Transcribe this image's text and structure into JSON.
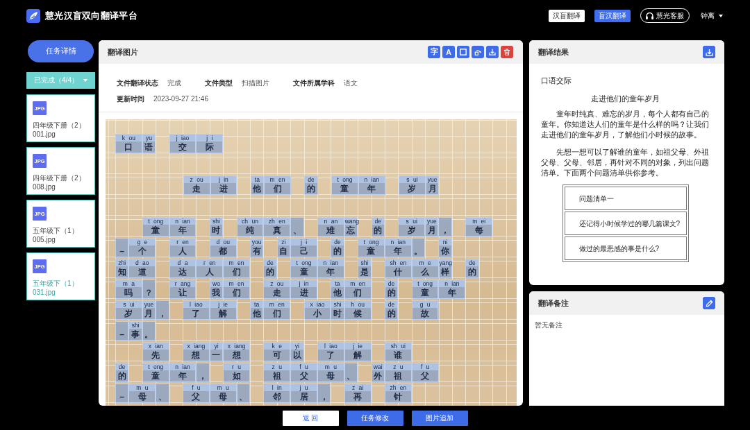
{
  "app": {
    "title": "慧光汉盲双向翻译平台"
  },
  "top_nav": {
    "modes": [
      {
        "label": "汉盲翻译",
        "selected": false
      },
      {
        "label": "盲汉翻译",
        "selected": true
      }
    ],
    "support": {
      "label": "慧光客服"
    },
    "user": {
      "name": "钟离"
    }
  },
  "sidebar": {
    "task_button": "任务详情",
    "filter": {
      "label": "已完成（4/4）"
    },
    "files": [
      {
        "type_label": "JPG",
        "name": "四年级下册（2）001.jpg",
        "selected": false
      },
      {
        "type_label": "JPG",
        "name": "四年级下册（2）008.jpg",
        "selected": false
      },
      {
        "type_label": "JPG",
        "name": "五年级下（1）005.jpg",
        "selected": false
      },
      {
        "type_label": "JPG",
        "name": "五年级下（1）031.jpg",
        "selected": true
      }
    ]
  },
  "image_panel": {
    "title": "翻译图片",
    "tools": [
      {
        "kind": "glyph",
        "label": "字"
      },
      {
        "kind": "glyph",
        "label": "A"
      },
      {
        "kind": "frame"
      },
      {
        "kind": "rotate"
      },
      {
        "kind": "download"
      },
      {
        "kind": "delete"
      }
    ],
    "details": [
      {
        "label": "文件翻译状态",
        "value": "完成"
      },
      {
        "label": "文件类型",
        "value": "扫描图片"
      },
      {
        "label": "文件所属学科",
        "value": "语文"
      },
      {
        "label": "更新时间",
        "value": "2023-09-27 21:46"
      }
    ],
    "scan": {
      "lines": [
        {
          "kind": "heading",
          "words": [
            [
              {
                "char": "口",
                "pinyin": "k ou"
              },
              {
                "char": "语",
                "pinyin": "yu"
              }
            ],
            [
              {
                "char": "交",
                "pinyin": "j iao"
              },
              {
                "char": "际",
                "pinyin": "j i"
              }
            ]
          ]
        },
        {
          "kind": "title",
          "words": [
            [
              {
                "char": "走",
                "pinyin": "z ou"
              },
              {
                "char": "进",
                "pinyin": "j in"
              }
            ],
            [
              {
                "char": "他",
                "pinyin": "ta"
              },
              {
                "char": "们",
                "pinyin": "m en"
              }
            ],
            [
              {
                "char": "的",
                "pinyin": "de"
              }
            ],
            [
              {
                "char": "童",
                "pinyin": "t ong"
              },
              {
                "char": "年",
                "pinyin": "n ian"
              }
            ],
            [
              {
                "char": "岁",
                "pinyin": "s ui"
              },
              {
                "char": "月",
                "pinyin": "yue"
              }
            ]
          ]
        },
        {
          "kind": "indent",
          "words": [
            [
              {
                "char": "童",
                "pinyin": "t ong"
              },
              {
                "char": "年",
                "pinyin": "n ian"
              }
            ],
            [
              {
                "char": "时",
                "pinyin": "shi"
              }
            ],
            [
              {
                "char": "纯",
                "pinyin": "ch un"
              },
              {
                "char": "真",
                "pinyin": "zh en"
              },
              {
                "char": "、"
              }
            ],
            [
              {
                "char": "难",
                "pinyin": "n an"
              },
              {
                "char": "忘",
                "pinyin": "wang"
              }
            ],
            [
              {
                "char": "的",
                "pinyin": "de"
              }
            ],
            [
              {
                "char": "岁",
                "pinyin": "s ui"
              },
              {
                "char": "月",
                "pinyin": "yue"
              },
              {
                "char": "，"
              }
            ],
            [
              {
                "char": "每",
                "pinyin": "m ei"
              }
            ]
          ]
        },
        {
          "kind": "line",
          "words": [
            [
              {
                "char": "–"
              },
              {
                "char": "个",
                "pinyin": "g e"
              }
            ],
            [
              {
                "char": "人",
                "pinyin": "r en"
              }
            ],
            [
              {
                "char": "都",
                "pinyin": "d ou"
              }
            ],
            [
              {
                "char": "有",
                "pinyin": "you"
              }
            ],
            [
              {
                "char": "自",
                "pinyin": "zi"
              },
              {
                "char": "己",
                "pinyin": "j i"
              }
            ],
            [
              {
                "char": "的",
                "pinyin": "de"
              }
            ],
            [
              {
                "char": "童",
                "pinyin": "t ong"
              },
              {
                "char": "年",
                "pinyin": "n ian"
              },
              {
                "char": "。"
              }
            ],
            [
              {
                "char": "你",
                "pinyin": "ni"
              }
            ]
          ]
        },
        {
          "kind": "line",
          "words": [
            [
              {
                "char": "知",
                "pinyin": "zhi"
              },
              {
                "char": "道",
                "pinyin": "d ao"
              }
            ],
            [
              {
                "char": "达",
                "pinyin": "d a"
              },
              {
                "char": "人",
                "pinyin": "r en"
              },
              {
                "char": "们",
                "pinyin": "m en"
              }
            ],
            [
              {
                "char": "的",
                "pinyin": "de"
              }
            ],
            [
              {
                "char": "童",
                "pinyin": "t ong"
              },
              {
                "char": "年",
                "pinyin": "n ian"
              }
            ],
            [
              {
                "char": "是",
                "pinyin": "shi"
              }
            ],
            [
              {
                "char": "什",
                "pinyin": "sh en"
              },
              {
                "char": "么",
                "pinyin": "m e"
              },
              {
                "char": "样",
                "pinyin": "yang"
              }
            ],
            [
              {
                "char": "的",
                "pinyin": "de"
              }
            ]
          ]
        },
        {
          "kind": "line",
          "words": [
            [
              {
                "char": "吗",
                "pinyin": "m a"
              },
              {
                "char": "？"
              }
            ],
            [
              {
                "char": "让",
                "pinyin": "r ang"
              }
            ],
            [
              {
                "char": "我",
                "pinyin": "wo"
              },
              {
                "char": "们",
                "pinyin": "m en"
              }
            ],
            [
              {
                "char": "走",
                "pinyin": "z ou"
              },
              {
                "char": "进",
                "pinyin": "j in"
              }
            ],
            [
              {
                "char": "他",
                "pinyin": "ta"
              },
              {
                "char": "们",
                "pinyin": "m en"
              }
            ],
            [
              {
                "char": "的",
                "pinyin": "de"
              }
            ],
            [
              {
                "char": "童",
                "pinyin": "t ong"
              },
              {
                "char": "年",
                "pinyin": "n ian"
              }
            ]
          ]
        },
        {
          "kind": "line",
          "words": [
            [
              {
                "char": "岁",
                "pinyin": "s ui"
              },
              {
                "char": "月",
                "pinyin": "yue"
              },
              {
                "char": "，"
              }
            ],
            [
              {
                "char": "了",
                "pinyin": "l iao"
              },
              {
                "char": "解",
                "pinyin": "j ie"
              }
            ],
            [
              {
                "char": "他",
                "pinyin": "ta"
              },
              {
                "char": "们",
                "pinyin": "m en"
              }
            ],
            [
              {
                "char": "小",
                "pinyin": "x iao"
              },
              {
                "char": "时",
                "pinyin": "shi"
              },
              {
                "char": "候",
                "pinyin": "h ou"
              }
            ],
            [
              {
                "char": "的",
                "pinyin": "de"
              }
            ],
            [
              {
                "char": "故",
                "pinyin": "g u"
              }
            ]
          ]
        },
        {
          "kind": "line",
          "words": [
            [
              {
                "char": "–"
              },
              {
                "char": "事",
                "pinyin": "shi"
              },
              {
                "char": "。"
              }
            ]
          ]
        },
        {
          "kind": "indent",
          "words": [
            [
              {
                "char": "先",
                "pinyin": "x ian"
              }
            ],
            [
              {
                "char": "想",
                "pinyin": "x iang"
              },
              {
                "char": "一",
                "pinyin": "yi"
              },
              {
                "char": "想",
                "pinyin": "x iang"
              }
            ],
            [
              {
                "char": "可",
                "pinyin": "k e"
              },
              {
                "char": "以",
                "pinyin": "yi"
              }
            ],
            [
              {
                "char": "了",
                "pinyin": "l iao"
              },
              {
                "char": "解",
                "pinyin": "j ie"
              }
            ],
            [
              {
                "char": "谁",
                "pinyin": "sh ui"
              }
            ]
          ]
        },
        {
          "kind": "line",
          "words": [
            [
              {
                "char": "的",
                "pinyin": "de"
              }
            ],
            [
              {
                "char": "童",
                "pinyin": "t ong"
              },
              {
                "char": "年",
                "pinyin": "n ian"
              },
              {
                "char": "，"
              }
            ],
            [
              {
                "char": "如",
                "pinyin": "r u"
              }
            ],
            [
              {
                "char": "祖",
                "pinyin": "z u"
              },
              {
                "char": "父",
                "pinyin": "f u"
              },
              {
                "char": "母",
                "pinyin": "m u"
              },
              {
                "char": "、"
              }
            ],
            [
              {
                "char": "外",
                "pinyin": "wai"
              },
              {
                "char": "祖",
                "pinyin": "z u"
              },
              {
                "char": "父",
                "pinyin": "f u"
              }
            ]
          ]
        },
        {
          "kind": "line",
          "words": [
            [
              {
                "char": "–"
              },
              {
                "char": "母",
                "pinyin": "m u"
              },
              {
                "char": "、"
              }
            ],
            [
              {
                "char": "父",
                "pinyin": "f u"
              },
              {
                "char": "母",
                "pinyin": "m u"
              },
              {
                "char": "、"
              }
            ],
            [
              {
                "char": "邻",
                "pinyin": "l in"
              },
              {
                "char": "居",
                "pinyin": "j u"
              },
              {
                "char": "，"
              }
            ],
            [
              {
                "char": "再",
                "pinyin": "z ai"
              }
            ],
            [
              {
                "char": "针",
                "pinyin": "zh en"
              }
            ]
          ]
        }
      ]
    }
  },
  "result_panel": {
    "title": "翻译结果",
    "blocks": [
      {
        "kind": "heading",
        "text": "口语交际"
      },
      {
        "kind": "title",
        "text": "走进他们的童年岁月"
      },
      {
        "kind": "paragraph",
        "text": "童年时纯真、难忘的岁月，每个人都有自己的童年。你知道达人们的童年是什么样的吗？让我们走进他们的童年岁月，了解他们小时候的故事。"
      },
      {
        "kind": "paragraph",
        "text": "先想一想可以了解谁的童年，如祖父母、外祖父母、父母、邻居，再针对不同的对象，列出问题清单。下面两个问题清单供你参考。"
      },
      {
        "kind": "table",
        "rows": [
          "问题清单一",
          "还记得小时候学过的哪几篇课文?",
          "做过的最恶感的事是什么?"
        ]
      }
    ]
  },
  "notes_panel": {
    "title": "翻译备注",
    "text": "暂无备注"
  },
  "footer": {
    "buttons": [
      {
        "kind": "secondary",
        "label": "返 回"
      },
      {
        "kind": "primary",
        "label": "任务修改"
      },
      {
        "kind": "primary",
        "label": "图片追加"
      }
    ]
  }
}
